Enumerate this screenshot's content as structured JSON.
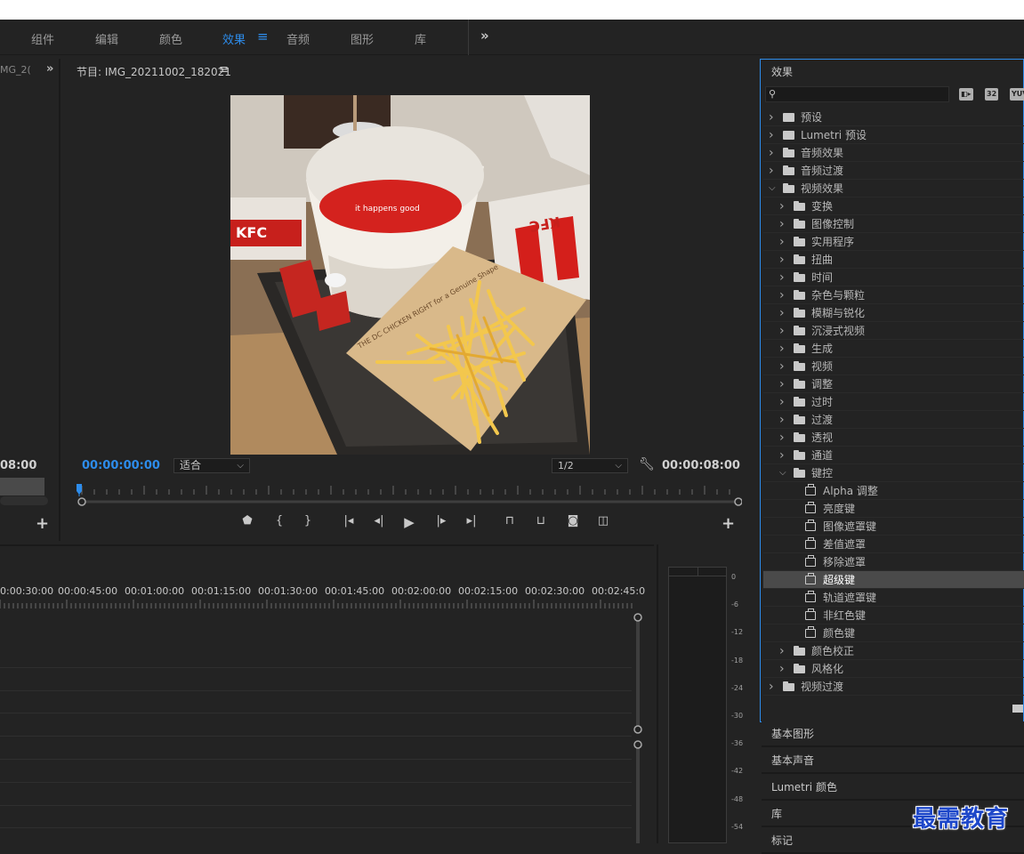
{
  "menubar": {
    "items": [
      {
        "label": "组件",
        "active": false
      },
      {
        "label": "编辑",
        "active": false
      },
      {
        "label": "颜色",
        "active": false
      },
      {
        "label": "效果",
        "active": true
      },
      {
        "label": "音频",
        "active": false
      },
      {
        "label": "图形",
        "active": false
      },
      {
        "label": "库",
        "active": false
      }
    ],
    "active_menu_glyph": "≡",
    "more_glyph": "»"
  },
  "source": {
    "tab_label": "MG_2(",
    "more_glyph": "»",
    "timecode": "08:00",
    "add_glyph": "+"
  },
  "program": {
    "title": "节目: IMG_20211002_182021",
    "menu_glyph": "≡",
    "timecode_current": "00:00:00:00",
    "zoom_select": "适合",
    "resolution_select": "1/2",
    "timecode_duration": "00:00:08:00",
    "add_glyph": "+",
    "video_text": {
      "left_box": "KFC",
      "right_box": "KFC",
      "bucket": "it happens good",
      "wrapper": "THE DC CHICKEN RIGHT for a Genuine Shape"
    }
  },
  "timeline": {
    "ruler_labels": [
      "0:00:30:00",
      "00:00:45:00",
      "00:01:00:00",
      "00:01:15:00",
      "00:01:30:00",
      "00:01:45:00",
      "00:02:00:00",
      "00:02:15:00",
      "00:02:30:00",
      "00:02:45:0"
    ]
  },
  "meter": {
    "db_labels": [
      "0",
      "-6",
      "-12",
      "-18",
      "-24",
      "-30",
      "-36",
      "-42",
      "-48",
      "-54"
    ]
  },
  "effects": {
    "title": "效果",
    "search_placeholder": "",
    "badges": [
      "32",
      "YUV"
    ],
    "tree": [
      {
        "label": "预设",
        "level": 0,
        "icon": "preset",
        "expanded": false,
        "selected": false
      },
      {
        "label": "Lumetri 预设",
        "level": 0,
        "icon": "preset",
        "expanded": false,
        "selected": false
      },
      {
        "label": "音频效果",
        "level": 0,
        "icon": "folder",
        "expanded": false,
        "selected": false
      },
      {
        "label": "音频过渡",
        "level": 0,
        "icon": "folder",
        "expanded": false,
        "selected": false
      },
      {
        "label": "视频效果",
        "level": 0,
        "icon": "folder",
        "expanded": true,
        "selected": false
      },
      {
        "label": "变换",
        "level": 1,
        "icon": "folder",
        "expanded": false,
        "selected": false
      },
      {
        "label": "图像控制",
        "level": 1,
        "icon": "folder",
        "expanded": false,
        "selected": false
      },
      {
        "label": "实用程序",
        "level": 1,
        "icon": "folder",
        "expanded": false,
        "selected": false
      },
      {
        "label": "扭曲",
        "level": 1,
        "icon": "folder",
        "expanded": false,
        "selected": false
      },
      {
        "label": "时间",
        "level": 1,
        "icon": "folder",
        "expanded": false,
        "selected": false
      },
      {
        "label": "杂色与颗粒",
        "level": 1,
        "icon": "folder",
        "expanded": false,
        "selected": false
      },
      {
        "label": "模糊与锐化",
        "level": 1,
        "icon": "folder",
        "expanded": false,
        "selected": false
      },
      {
        "label": "沉浸式视频",
        "level": 1,
        "icon": "folder",
        "expanded": false,
        "selected": false
      },
      {
        "label": "生成",
        "level": 1,
        "icon": "folder",
        "expanded": false,
        "selected": false
      },
      {
        "label": "视频",
        "level": 1,
        "icon": "folder",
        "expanded": false,
        "selected": false
      },
      {
        "label": "调整",
        "level": 1,
        "icon": "folder",
        "expanded": false,
        "selected": false
      },
      {
        "label": "过时",
        "level": 1,
        "icon": "folder",
        "expanded": false,
        "selected": false
      },
      {
        "label": "过渡",
        "level": 1,
        "icon": "folder",
        "expanded": false,
        "selected": false
      },
      {
        "label": "透视",
        "level": 1,
        "icon": "folder",
        "expanded": false,
        "selected": false
      },
      {
        "label": "通道",
        "level": 1,
        "icon": "folder",
        "expanded": false,
        "selected": false
      },
      {
        "label": "键控",
        "level": 1,
        "icon": "folder",
        "expanded": true,
        "selected": false
      },
      {
        "label": "Alpha 调整",
        "level": 2,
        "icon": "fx",
        "expanded": false,
        "selected": false
      },
      {
        "label": "亮度键",
        "level": 2,
        "icon": "fx",
        "expanded": false,
        "selected": false
      },
      {
        "label": "图像遮罩键",
        "level": 2,
        "icon": "fx",
        "expanded": false,
        "selected": false
      },
      {
        "label": "差值遮罩",
        "level": 2,
        "icon": "fx",
        "expanded": false,
        "selected": false
      },
      {
        "label": "移除遮罩",
        "level": 2,
        "icon": "fx",
        "expanded": false,
        "selected": false
      },
      {
        "label": "超级键",
        "level": 2,
        "icon": "fx",
        "expanded": false,
        "selected": true
      },
      {
        "label": "轨道遮罩键",
        "level": 2,
        "icon": "fx",
        "expanded": false,
        "selected": false
      },
      {
        "label": "非红色键",
        "level": 2,
        "icon": "fx",
        "expanded": false,
        "selected": false
      },
      {
        "label": "颜色键",
        "level": 2,
        "icon": "fx",
        "expanded": false,
        "selected": false
      },
      {
        "label": "颜色校正",
        "level": 1,
        "icon": "folder",
        "expanded": false,
        "selected": false
      },
      {
        "label": "风格化",
        "level": 1,
        "icon": "folder",
        "expanded": false,
        "selected": false
      },
      {
        "label": "视频过渡",
        "level": 0,
        "icon": "folder",
        "expanded": false,
        "selected": false
      }
    ]
  },
  "collapsed_panels": [
    "基本图形",
    "基本声音",
    "Lumetri 颜色",
    "库",
    "标记"
  ],
  "watermark": "最需教育",
  "colors": {
    "accent": "#2d8ceb",
    "background": "#232323",
    "selected_row": "#4a4a4a"
  }
}
